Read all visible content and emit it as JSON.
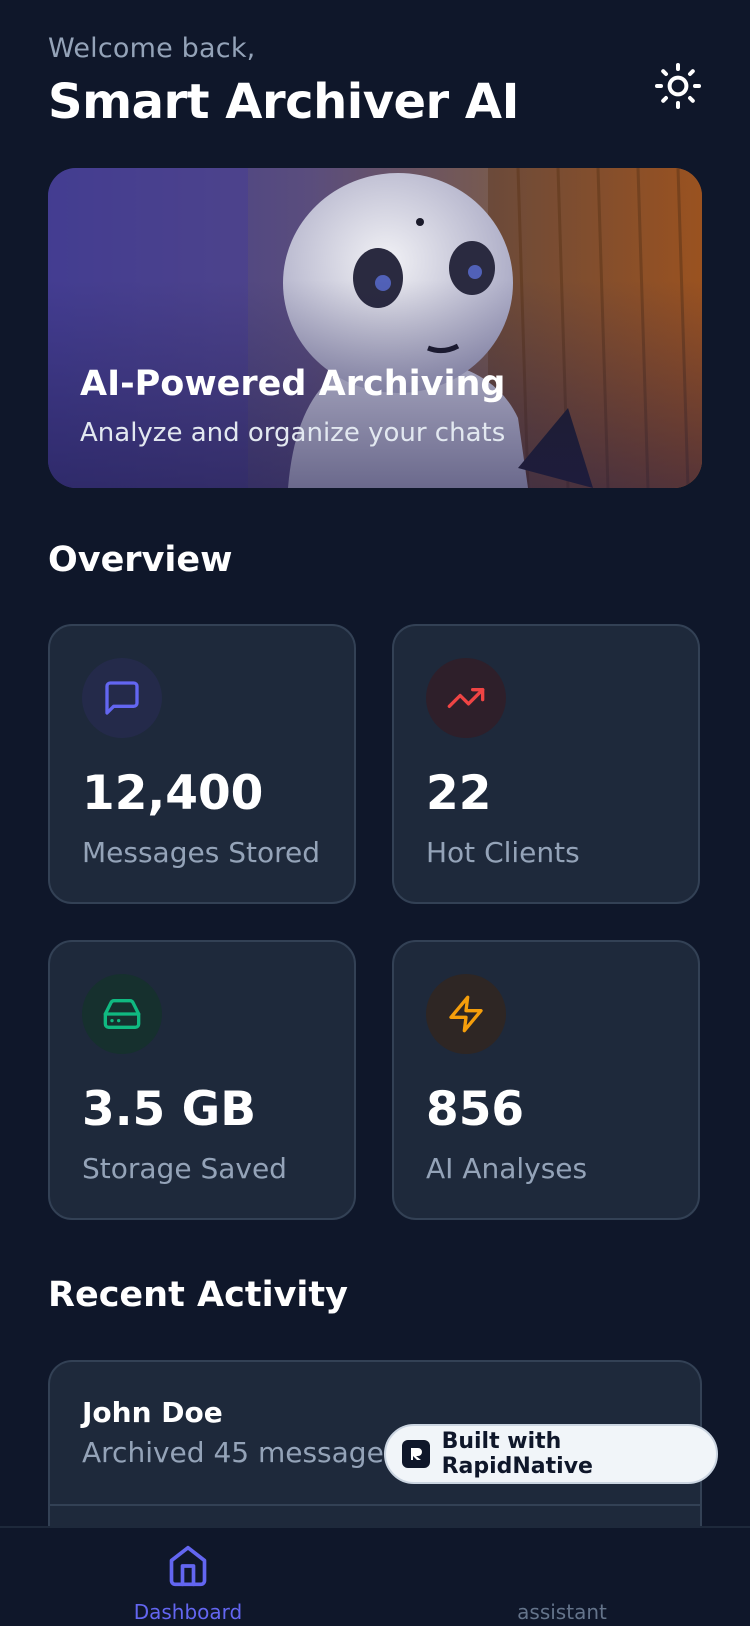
{
  "header": {
    "welcome": "Welcome back,",
    "title": "Smart Archiver AI",
    "theme_icon": "sun-icon"
  },
  "hero": {
    "title": "AI-Powered Archiving",
    "subtitle": "Analyze and organize your chats"
  },
  "overview": {
    "title": "Overview",
    "stats": [
      {
        "value": "12,400",
        "label": "Messages Stored",
        "icon": "message-square-icon",
        "color": "#6366f1"
      },
      {
        "value": "22",
        "label": "Hot Clients",
        "icon": "trending-up-icon",
        "color": "#ef4444"
      },
      {
        "value": "3.5 GB",
        "label": "Storage Saved",
        "icon": "hard-drive-icon",
        "color": "#10b981"
      },
      {
        "value": "856",
        "label": "AI Analyses",
        "icon": "zap-icon",
        "color": "#f59e0b"
      }
    ]
  },
  "recent_activity": {
    "title": "Recent Activity",
    "items": [
      {
        "name": "John Doe",
        "description": "Archived 45 messages"
      }
    ]
  },
  "badge": {
    "text": "Built with RapidNative"
  },
  "bottom_nav": {
    "items": [
      {
        "label": "Dashboard",
        "icon": "home-icon",
        "active": true
      },
      {
        "label": "assistant",
        "icon": "",
        "active": false
      }
    ],
    "active_color": "#6366f1",
    "inactive_color": "#64748b"
  },
  "colors": {
    "background": "#0f172a",
    "card": "#1e293b",
    "border": "#334155",
    "muted_text": "#94a3b8"
  }
}
